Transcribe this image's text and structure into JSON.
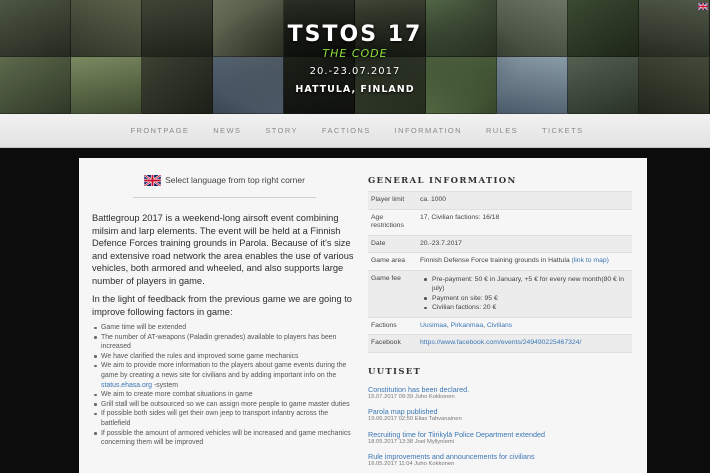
{
  "header": {
    "title": "TSTOS 17",
    "subtitle": "THE CODE",
    "dates": "20.-23.07.2017",
    "location": "HATTULA, FINLAND"
  },
  "nav": {
    "items": [
      "FRONTPAGE",
      "NEWS",
      "STORY",
      "FACTIONS",
      "INFORMATION",
      "RULES",
      "TICKETS"
    ]
  },
  "language": {
    "label": "Select language from top right corner"
  },
  "intro": {
    "paragraph": "Battlegroup 2017 is a weekend-long airsoft event combining milsim and larp elements. The event will be held at a Finnish Defence Forces training grounds in Parola. Because of it's size and extensive road network the area enables the use of various vehicles, both armored and wheeled, and also supports large number of players in game.",
    "feedback": "In the light of feedback from the previous game we are going to improve following factors in game:",
    "bullets": {
      "b1": "Game time will be extended",
      "b2": "The number of AT-weapons (Paladin grenades) available to players has been increased",
      "b3": "We have clarified the rules and improved some game mechanics",
      "b4_pre": "We aim to provide more information to the players about game events during the game by creating a news site for civilians and by adding important info on the ",
      "b4_link": "status.ehasa.org",
      "b4_post": " -system",
      "b5": "We aim to create more combat situations in game",
      "b6": "Grill stall will be outsourced so we can assign more people to game master duties",
      "b7": "If possible both sides will get their own jeep to transport infantry across the battlefield",
      "b8": "If possible the amount of armored vehicles will be increased and game mechanics concerning them will be improved"
    }
  },
  "general_info": {
    "heading": "GENERAL INFORMATION",
    "rows": {
      "players_key": "Player limit",
      "players_val": "ca. 1000",
      "age_key": "Age restrictions",
      "age_val": "17, Civilian factions: 16/18",
      "date_key": "Date",
      "date_val": "20.-23.7.2017",
      "area_key": "Game area",
      "area_val": "Finnish Defense Force training grounds in Hattula ",
      "area_link": "(link to map)",
      "fee_key": "Game fee",
      "fee_1": "Pre-payment: 50 € in January, +5 € for every new month(80 € in july)",
      "fee_2": "Payment on site: 95 €",
      "fee_3": "Civilian factions: 20 €",
      "factions_key": "Factions",
      "faction_1": "Uusimaa",
      "faction_2": "Pirkanmaa",
      "faction_3": "Civilians",
      "facebook_key": "Facebook",
      "facebook_val": "https://www.facebook.com/events/249490225467324/"
    }
  },
  "news": {
    "heading": "UUTISET",
    "items": [
      {
        "title": "Constitution has been declared.",
        "meta": "15.07.2017 09:39 Juho Kokkonen"
      },
      {
        "title": "Parola map published",
        "meta": "19.06.2017 02:50 Elias Tahvanainen"
      },
      {
        "title": "Recruiting time for Tiirikylä Police Department extended",
        "meta": "18.05.2017 13:38 Joel Myllyniemi"
      },
      {
        "title": "Rule improvements and announcements for civilians",
        "meta": "16.05.2017 11:04 Juho Kokkonen"
      }
    ]
  }
}
